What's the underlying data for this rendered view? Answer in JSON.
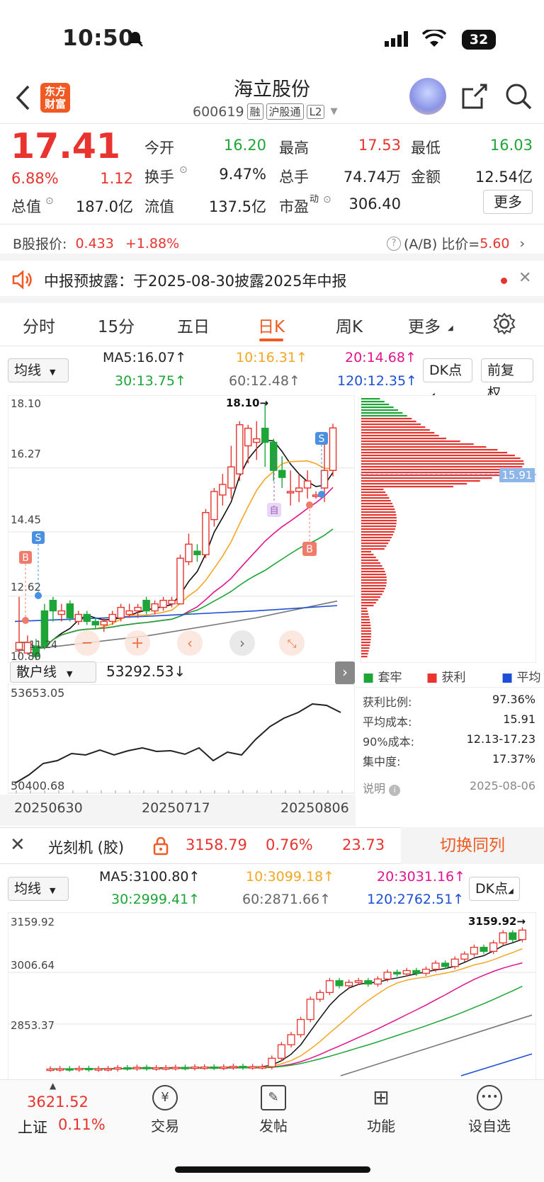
{
  "status_bar": {
    "time": "10:50",
    "battery": "32"
  },
  "header": {
    "logo": "东方财富",
    "title": "海立股份",
    "code": "600619",
    "tags": [
      "融",
      "沪股通",
      "L2"
    ]
  },
  "quote": {
    "price": "17.41",
    "change_pct": "6.88%",
    "change": "1.12",
    "items": [
      {
        "label": "今开",
        "value": "16.20",
        "color": "green"
      },
      {
        "label": "最高",
        "value": "17.53",
        "color": "red"
      },
      {
        "label": "最低",
        "value": "16.03",
        "color": "green"
      },
      {
        "label": "换手",
        "value": "9.47%",
        "color": "black"
      },
      {
        "label": "总手",
        "value": "74.74万",
        "color": "black"
      },
      {
        "label": "金额",
        "value": "12.54亿",
        "color": "black"
      },
      {
        "label": "总值",
        "value": "187.0亿",
        "color": "black"
      },
      {
        "label": "流值",
        "value": "137.5亿",
        "color": "black"
      },
      {
        "label": "市盈",
        "value": "306.40",
        "color": "black"
      }
    ],
    "pe_superscript": "动",
    "more_button": "更多"
  },
  "b_share": {
    "label": "B股报价:",
    "price": "0.433",
    "change": "+1.88%",
    "ratio_label": "(A/B) 比价=",
    "ratio_value": "5.60"
  },
  "announcement": {
    "text": "中报预披露：于2025-08-30披露2025年中报"
  },
  "tabs": [
    "分时",
    "15分",
    "五日",
    "日K",
    "周K",
    "更多"
  ],
  "active_tab": "日K",
  "main_chart": {
    "indicator_select": "均线",
    "ma": [
      {
        "text": "MA5:16.07↑",
        "color": "#111111"
      },
      {
        "text": "10:16.31↑",
        "color": "#f5a623"
      },
      {
        "text": "20:14.68↑",
        "color": "#e0148c"
      },
      {
        "text": "30:13.75↑",
        "color": "#1ea538"
      },
      {
        "text": "60:12.48↑",
        "color": "#666666"
      },
      {
        "text": "120:12.35↑",
        "color": "#1d4fd6"
      }
    ],
    "dk_button": "DK点",
    "adj_button": "前复权",
    "y_ticks": [
      "18.10",
      "16.27",
      "14.45",
      "12.62",
      "10.80"
    ],
    "high_label": "18.10→",
    "low_label": "11.24",
    "cost_line_label": "15.91",
    "markers": {
      "buy": "B",
      "sell": "S",
      "self": "自"
    }
  },
  "sub_chart": {
    "select": "散户线",
    "value": "53292.53↓",
    "max": "53653.05",
    "min": "50400.68",
    "dates": [
      "20250630",
      "20250717",
      "20250806"
    ]
  },
  "chip_panel": {
    "legend": [
      "套牢",
      "获利",
      "平均"
    ],
    "stats": [
      {
        "label": "获利比例:",
        "value": "97.36%"
      },
      {
        "label": "平均成本:",
        "value": "15.91"
      },
      {
        "label": "90%成本:",
        "value": "12.13-17.23"
      },
      {
        "label": "集中度:",
        "value": "17.37%"
      }
    ],
    "note": "说明",
    "date": "2025-08-06"
  },
  "sector": {
    "name": "光刻机 (胶)",
    "price": "3158.79",
    "change_pct": "0.76%",
    "change": "23.73",
    "switch_label": "切换同列"
  },
  "sector_chart": {
    "indicator_select": "均线",
    "ma": [
      {
        "text": "MA5:3100.80↑",
        "color": "#111111"
      },
      {
        "text": "10:3099.18↑",
        "color": "#f5a623"
      },
      {
        "text": "20:3031.16↑",
        "color": "#e0148c"
      },
      {
        "text": "30:2999.41↑",
        "color": "#1ea538"
      },
      {
        "text": "60:2871.66↑",
        "color": "#666666"
      },
      {
        "text": "120:2762.51↑",
        "color": "#1d4fd6"
      }
    ],
    "dk_button": "DK点",
    "y_ticks": [
      "3159.92",
      "3006.64",
      "2853.37"
    ],
    "high_label": "3159.92→"
  },
  "bottom_nav": {
    "index_value": "3621.52",
    "index_name": "上证",
    "index_change": "0.11%",
    "items": [
      {
        "label": "交易",
        "icon": "yen-icon"
      },
      {
        "label": "发帖",
        "icon": "edit-icon"
      },
      {
        "label": "功能",
        "icon": "grid-icon"
      },
      {
        "label": "设自选",
        "icon": "chat-icon"
      }
    ]
  },
  "colors": {
    "up": "#e8332e",
    "down": "#1ea538",
    "accent": "#f05a22"
  }
}
